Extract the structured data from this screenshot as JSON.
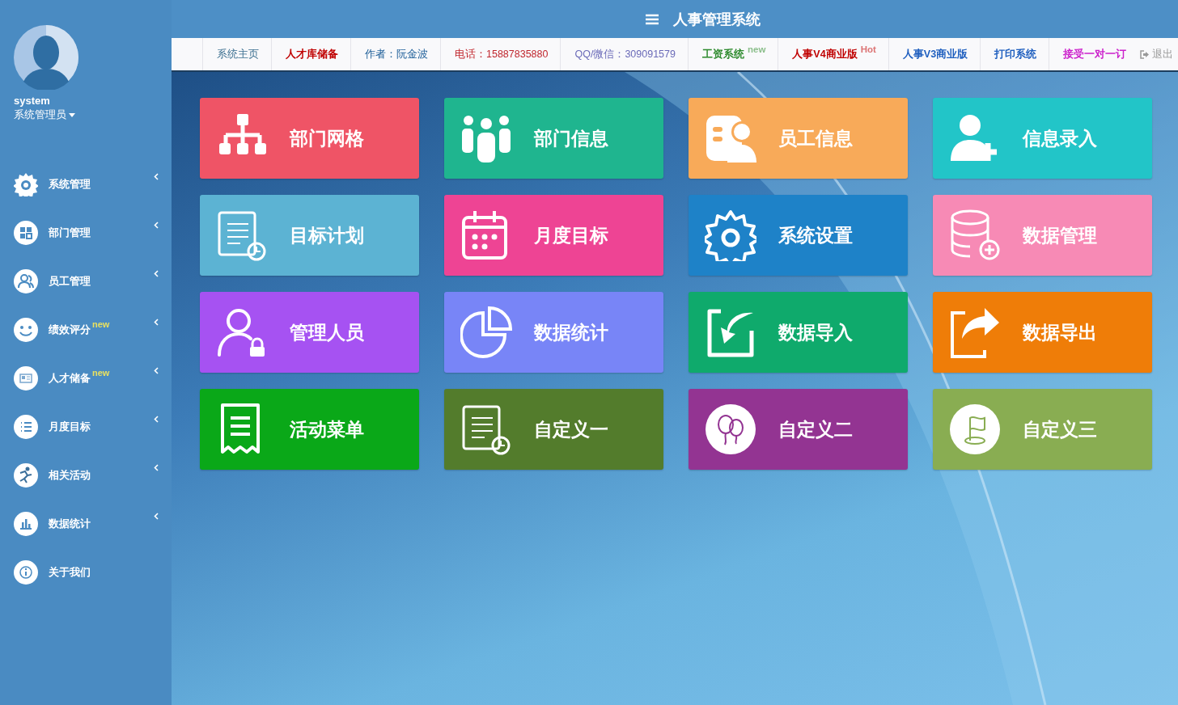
{
  "header": {
    "title": "人事管理系统"
  },
  "user": {
    "name": "system",
    "role": "系统管理员"
  },
  "sidebar": {
    "items": [
      {
        "label": "系统管理",
        "collapsible": true
      },
      {
        "label": "部门管理",
        "collapsible": true
      },
      {
        "label": "员工管理",
        "collapsible": true
      },
      {
        "label": "绩效评分",
        "badge": "new",
        "collapsible": true
      },
      {
        "label": "人才储备",
        "badge": "new",
        "collapsible": true
      },
      {
        "label": "月度目标",
        "collapsible": true
      },
      {
        "label": "相关活动",
        "collapsible": true
      },
      {
        "label": "数据统计",
        "collapsible": true
      },
      {
        "label": "关于我们",
        "collapsible": false
      }
    ]
  },
  "nav": {
    "links": [
      {
        "label": "系统主页",
        "color": "#3a6e8f",
        "bold": false
      },
      {
        "label": "人才库储备",
        "color": "#c00000",
        "bold": true
      },
      {
        "label": "作者：阮金波",
        "color": "#1f5f99",
        "bold": false
      },
      {
        "label": "电话：15887835880",
        "color": "#c0262d",
        "bold": false
      },
      {
        "label": "QQ/微信：309091579",
        "color": "#6a6ab8",
        "bold": false
      },
      {
        "label": "工资系统",
        "badge": "new",
        "color": "#2e8b2e",
        "bold": true
      },
      {
        "label": "人事V4商业版",
        "badge": "Hot",
        "color": "#c00000",
        "bold": true
      },
      {
        "label": "人事V3商业版",
        "color": "#1f5fbf",
        "bold": true
      },
      {
        "label": "打印系统",
        "color": "#1f5fbf",
        "bold": true
      },
      {
        "label": "接受一对一订",
        "color": "#cc22cc",
        "bold": true
      }
    ],
    "logout": "退出"
  },
  "tiles": [
    {
      "label": "部门网格",
      "color": "#ef5466"
    },
    {
      "label": "部门信息",
      "color": "#1fb58f"
    },
    {
      "label": "员工信息",
      "color": "#f8aa59"
    },
    {
      "label": "信息录入",
      "color": "#22c5c8"
    },
    {
      "label": "目标计划",
      "color": "#5cb3d3"
    },
    {
      "label": "月度目标",
      "color": "#ee4494"
    },
    {
      "label": "系统设置",
      "color": "#1e82c8"
    },
    {
      "label": "数据管理",
      "color": "#f78ab5"
    },
    {
      "label": "管理人员",
      "color": "#a652f2"
    },
    {
      "label": "数据统计",
      "color": "#7885f7"
    },
    {
      "label": "数据导入",
      "color": "#0faa6c"
    },
    {
      "label": "数据导出",
      "color": "#ef7d08"
    },
    {
      "label": "活动菜单",
      "color": "#0aa818"
    },
    {
      "label": "自定义一",
      "color": "#537c2c"
    },
    {
      "label": "自定义二",
      "color": "#933492"
    },
    {
      "label": "自定义三",
      "color": "#89ad52"
    }
  ]
}
